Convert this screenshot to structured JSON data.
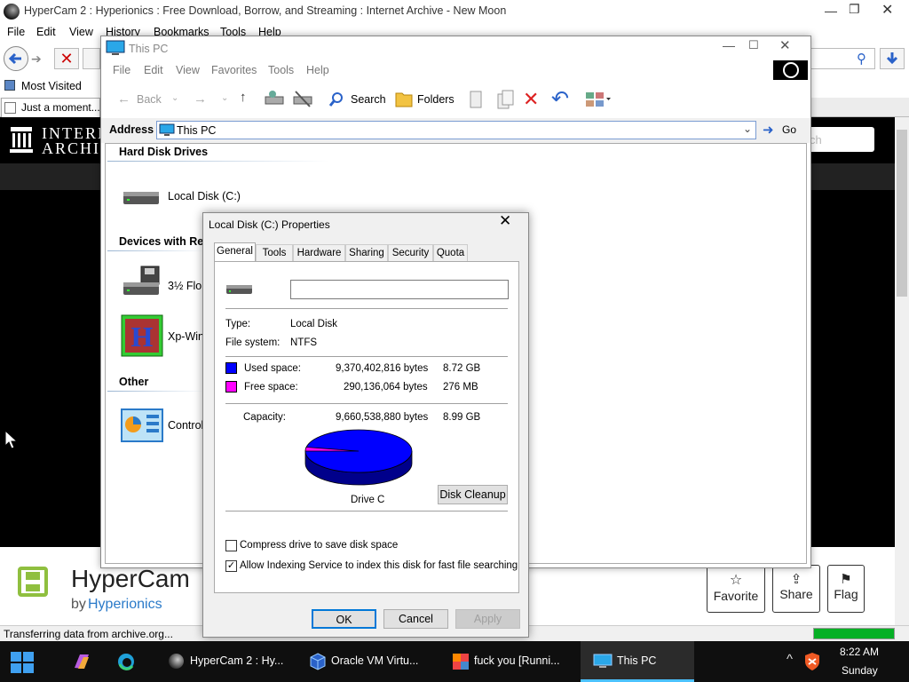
{
  "browser": {
    "title": "HyperCam 2 : Hyperionics : Free Download, Borrow, and Streaming : Internet Archive - New Moon",
    "menu": [
      "File",
      "Edit",
      "View",
      "History",
      "Bookmarks",
      "Tools",
      "Help"
    ],
    "bookmarks": {
      "most_visited": "Most Visited"
    },
    "tab_label": "Just a moment...",
    "status": "Transferring data from archive.org...",
    "progress_fraction": 1.0
  },
  "archive": {
    "logo_line1": "INTERN",
    "logo_line2": "ARCHIV",
    "search_placeholder": "ch",
    "item_title": "HyperCam",
    "by_prefix": "by",
    "author": "Hyperionics",
    "buttons": {
      "favorite": "Favorite",
      "share": "Share",
      "flag": "Flag"
    }
  },
  "explorer": {
    "title": "This PC",
    "menu": [
      "File",
      "Edit",
      "View",
      "Favorites",
      "Tools",
      "Help"
    ],
    "toolbar": {
      "back": "Back",
      "search": "Search",
      "folders": "Folders"
    },
    "address_label": "Address",
    "address_value": "This PC",
    "go_label": "Go",
    "groups": {
      "hard_disk": "Hard Disk Drives",
      "removable": "Devices with Ren",
      "other": "Other"
    },
    "items": {
      "local_disk": "Local Disk (C:)",
      "floppy": "3½ Flop",
      "xpwin": "Xp-Win",
      "control": "Control"
    }
  },
  "properties": {
    "title": "Local Disk (C:) Properties",
    "tabs": [
      "General",
      "Tools",
      "Hardware",
      "Sharing",
      "Security",
      "Quota"
    ],
    "active_tab": "General",
    "volume_label_value": "",
    "type_label": "Type:",
    "type_value": "Local Disk",
    "fs_label": "File system:",
    "fs_value": "NTFS",
    "used_label": "Used space:",
    "used_bytes": "9,370,402,816 bytes",
    "used_size": "8.72 GB",
    "free_label": "Free space:",
    "free_bytes": "290,136,064 bytes",
    "free_size": "276 MB",
    "capacity_label": "Capacity:",
    "capacity_bytes": "9,660,538,880 bytes",
    "capacity_size": "8.99 GB",
    "drive_caption": "Drive C",
    "disk_cleanup": "Disk Cleanup",
    "compress_label": "Compress drive to save disk space",
    "compress_checked": false,
    "index_label": "Allow Indexing Service to index this disk for fast file searching",
    "index_checked": true,
    "ok": "OK",
    "cancel": "Cancel",
    "apply": "Apply",
    "colors": {
      "used": "#0000ff",
      "free": "#ff00ff"
    }
  },
  "taskbar": {
    "items": [
      {
        "label": "HyperCam 2 : Hy...",
        "active": false
      },
      {
        "label": "Oracle VM Virtu...",
        "active": false
      },
      {
        "label": "fuck you [Runni...",
        "active": false
      },
      {
        "label": "This PC",
        "active": true
      }
    ],
    "time": "8:22 AM",
    "day": "Sunday"
  }
}
